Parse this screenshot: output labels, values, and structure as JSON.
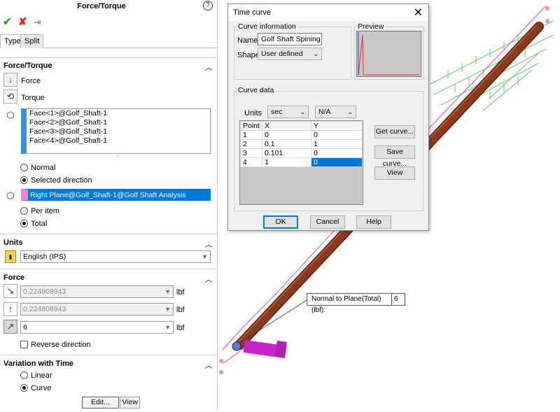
{
  "panel": {
    "title": "Force/Torque",
    "help_icon": "?",
    "ok_glyph": "✔",
    "cancel_glyph": "✘",
    "pin_glyph": "⇥",
    "tabs": [
      "Type",
      "Split"
    ],
    "force_torque": {
      "header": "Force/Torque",
      "force_label": "Force",
      "torque_label": "Torque",
      "faces": [
        "Face<1>@Golf_Shaft-1",
        "Face<2>@Golf_Shaft-1",
        "Face<3>@Golf_Shaft-1",
        "Face<4>@Golf_Shaft-1"
      ],
      "normal_label": "Normal",
      "selected_direction_label": "Selected direction",
      "direction_ref": "Right Plane@Golf_Shaft-1@Golf Shaft Analysis",
      "per_item_label": "Per item",
      "total_label": "Total"
    },
    "units": {
      "header": "Units",
      "value": "English (IPS)"
    },
    "force": {
      "header": "Force",
      "v1": "0.224808943",
      "v2": "0.224808943",
      "v3": "6",
      "unit": "lbf",
      "reverse_label": "Reverse direction"
    },
    "variation": {
      "header": "Variation with Time",
      "linear_label": "Linear",
      "curve_label": "Curve",
      "edit_label": "Edit...",
      "view_label": "View"
    }
  },
  "dialog": {
    "title": "Time curve",
    "close_glyph": "✕",
    "curve_info_label": "Curve information",
    "name_label": "Name",
    "name_value": "Golf Shaft Spining",
    "shape_label": "Shape",
    "shape_value": "User defined",
    "preview_label": "Preview",
    "curve_data_label": "Curve data",
    "units_label": "Units",
    "units_x": "sec",
    "units_y": "N/A",
    "columns": [
      "Point",
      "X",
      "Y"
    ],
    "rows": [
      [
        "1",
        "0",
        "0"
      ],
      [
        "2",
        "0.1",
        "1"
      ],
      [
        "3",
        "0.101",
        "0"
      ],
      [
        "4",
        "1",
        "0"
      ]
    ],
    "get_curve": "Get curve...",
    "save_curve": "Save curve...",
    "view": "View",
    "ok": "OK",
    "cancel": "Cancel",
    "help": "Help"
  },
  "callout": {
    "label": "Normal to Plane(Total) (lbf):",
    "value": "6"
  },
  "colors": {
    "shaft": "#8b3a1e",
    "grip": "#cc22cc",
    "load_arrows": "#3fc23f",
    "selection": "#0078d7"
  }
}
